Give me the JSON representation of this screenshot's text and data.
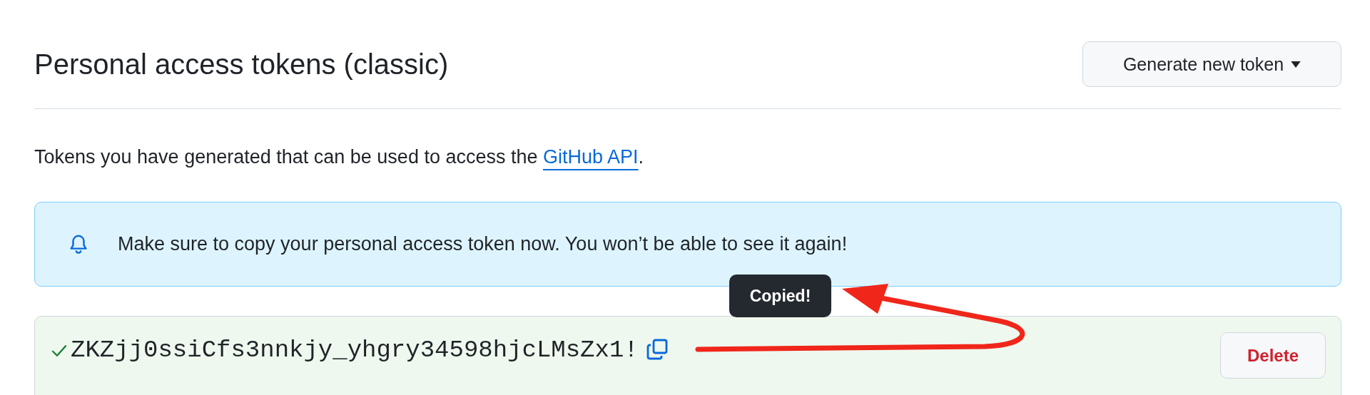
{
  "title": "Personal access tokens (classic)",
  "generate_button": {
    "label": "Generate new token"
  },
  "description": {
    "before": "Tokens you have generated that can be used to access the ",
    "link": "GitHub API",
    "after": "."
  },
  "flash": {
    "message": "Make sure to copy your personal access token now. You won’t be able to see it again!"
  },
  "token": {
    "value": "ZKZjj0ssiCfs3nnkjy_yhgry34598hjcLMsZx1!",
    "tooltip": "Copied!",
    "delete_label": "Delete"
  }
}
